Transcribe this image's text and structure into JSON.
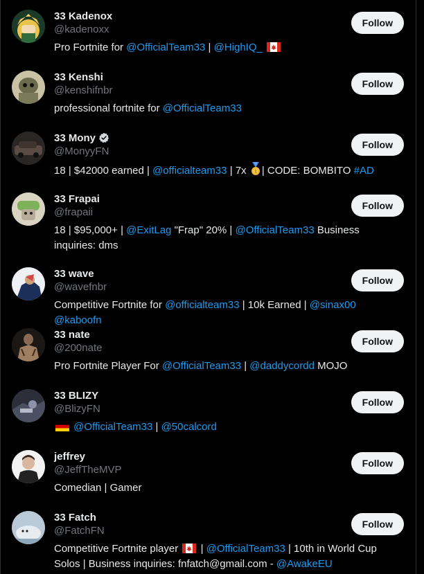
{
  "follow_label": "Follow",
  "colors": {
    "background": "#000000",
    "text": "#e7e9ea",
    "muted": "#71767b",
    "link": "#1d9bf0",
    "button_bg": "#eff3f4"
  },
  "users": [
    {
      "name": "33 Kadenox",
      "handle": "@kadenoxx",
      "verified": false,
      "bio": [
        {
          "t": "text",
          "v": "Pro Fortnite for "
        },
        {
          "t": "link",
          "v": "@OfficialTeam33"
        },
        {
          "t": "text",
          "v": " | "
        },
        {
          "t": "link",
          "v": "@HighIQ_"
        },
        {
          "t": "text",
          "v": " "
        },
        {
          "t": "icon",
          "v": "canada-flag"
        }
      ]
    },
    {
      "name": "33 Kenshi",
      "handle": "@kenshifnbr",
      "verified": false,
      "bio": [
        {
          "t": "text",
          "v": "professional fortnite for "
        },
        {
          "t": "link",
          "v": "@OfficialTeam33"
        }
      ]
    },
    {
      "name": "33 Mony",
      "handle": "@MonyyFN",
      "verified": true,
      "bio": [
        {
          "t": "text",
          "v": "18 | $42000 earned | "
        },
        {
          "t": "link",
          "v": "@officialteam33"
        },
        {
          "t": "text",
          "v": " | 7x "
        },
        {
          "t": "icon",
          "v": "gold-medal"
        },
        {
          "t": "text",
          "v": "| CODE: BOMBITO "
        },
        {
          "t": "link",
          "v": "#AD"
        }
      ]
    },
    {
      "name": "33 Frapai",
      "handle": "@frapaii",
      "verified": false,
      "bio": [
        {
          "t": "text",
          "v": "18 | $95,000+ | "
        },
        {
          "t": "link",
          "v": "@ExitLag"
        },
        {
          "t": "text",
          "v": " \"Frap\" 20% | "
        },
        {
          "t": "link",
          "v": "@OfficialTeam33"
        },
        {
          "t": "text",
          "v": " Business inquiries: dms"
        }
      ]
    },
    {
      "name": "33 wave",
      "handle": "@wavefnbr",
      "verified": false,
      "bio": [
        {
          "t": "text",
          "v": "Competitive Fortnite for "
        },
        {
          "t": "link",
          "v": "@officialteam33"
        },
        {
          "t": "text",
          "v": " | 10k Earned | "
        },
        {
          "t": "link",
          "v": "@sinax00"
        },
        {
          "t": "text",
          "v": " "
        },
        {
          "t": "link",
          "v": "@kaboofn"
        }
      ]
    },
    {
      "name": "33 nate",
      "handle": "@200nate",
      "verified": false,
      "bio": [
        {
          "t": "text",
          "v": "Pro Fortnite Player For "
        },
        {
          "t": "link",
          "v": "@OfficialTeam33"
        },
        {
          "t": "text",
          "v": " | "
        },
        {
          "t": "link",
          "v": "@daddycordd"
        },
        {
          "t": "text",
          "v": " MOJO"
        }
      ]
    },
    {
      "name": "33 BLIZY",
      "handle": "@BlizyFN",
      "verified": false,
      "bio": [
        {
          "t": "icon",
          "v": "germany-flag"
        },
        {
          "t": "text",
          "v": " "
        },
        {
          "t": "link",
          "v": "@OfficialTeam33"
        },
        {
          "t": "text",
          "v": " | "
        },
        {
          "t": "link",
          "v": "@50calcord"
        }
      ]
    },
    {
      "name": "jeffrey",
      "handle": "@JeffTheMVP",
      "verified": false,
      "bio": [
        {
          "t": "text",
          "v": "Comedian | Gamer"
        }
      ]
    },
    {
      "name": "33 Fatch",
      "handle": "@FatchFN",
      "verified": false,
      "bio": [
        {
          "t": "text",
          "v": "Competitive Fortnite player "
        },
        {
          "t": "icon",
          "v": "canada-flag"
        },
        {
          "t": "text",
          "v": " | "
        },
        {
          "t": "link",
          "v": "@OfficialTeam33"
        },
        {
          "t": "text",
          "v": " | 10th in World Cup Solos | Business inquiries: fnfatch@gmail.com - "
        },
        {
          "t": "link",
          "v": "@AwakeEU"
        }
      ]
    }
  ]
}
